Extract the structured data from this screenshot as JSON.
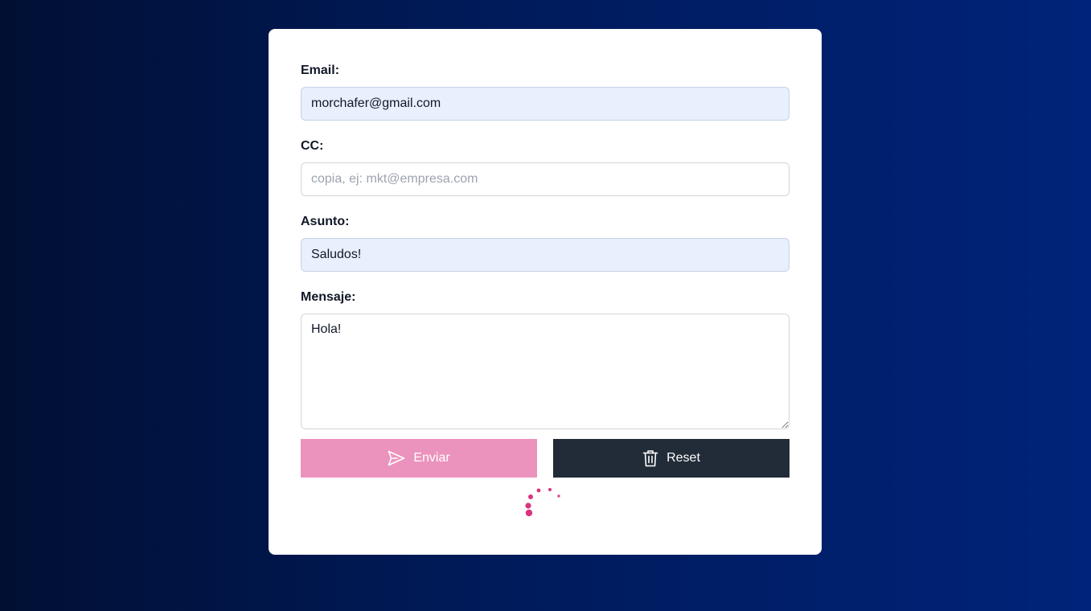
{
  "form": {
    "email": {
      "label": "Email:",
      "value": "morchafer@gmail.com"
    },
    "cc": {
      "label": "CC:",
      "value": "",
      "placeholder": "copia, ej: mkt@empresa.com"
    },
    "subject": {
      "label": "Asunto:",
      "value": "Saludos!"
    },
    "message": {
      "label": "Mensaje:",
      "value": "Hola!"
    }
  },
  "actions": {
    "send_label": "Enviar",
    "send_icon": "send-icon",
    "reset_label": "Reset",
    "reset_icon": "trash-icon"
  },
  "colors": {
    "send_button": "#ec93bd",
    "reset_button": "#222b38",
    "spinner": "#d9347f",
    "filled_input": "#e8effd"
  },
  "status": {
    "loading_icon": "loading-spinner-icon"
  }
}
